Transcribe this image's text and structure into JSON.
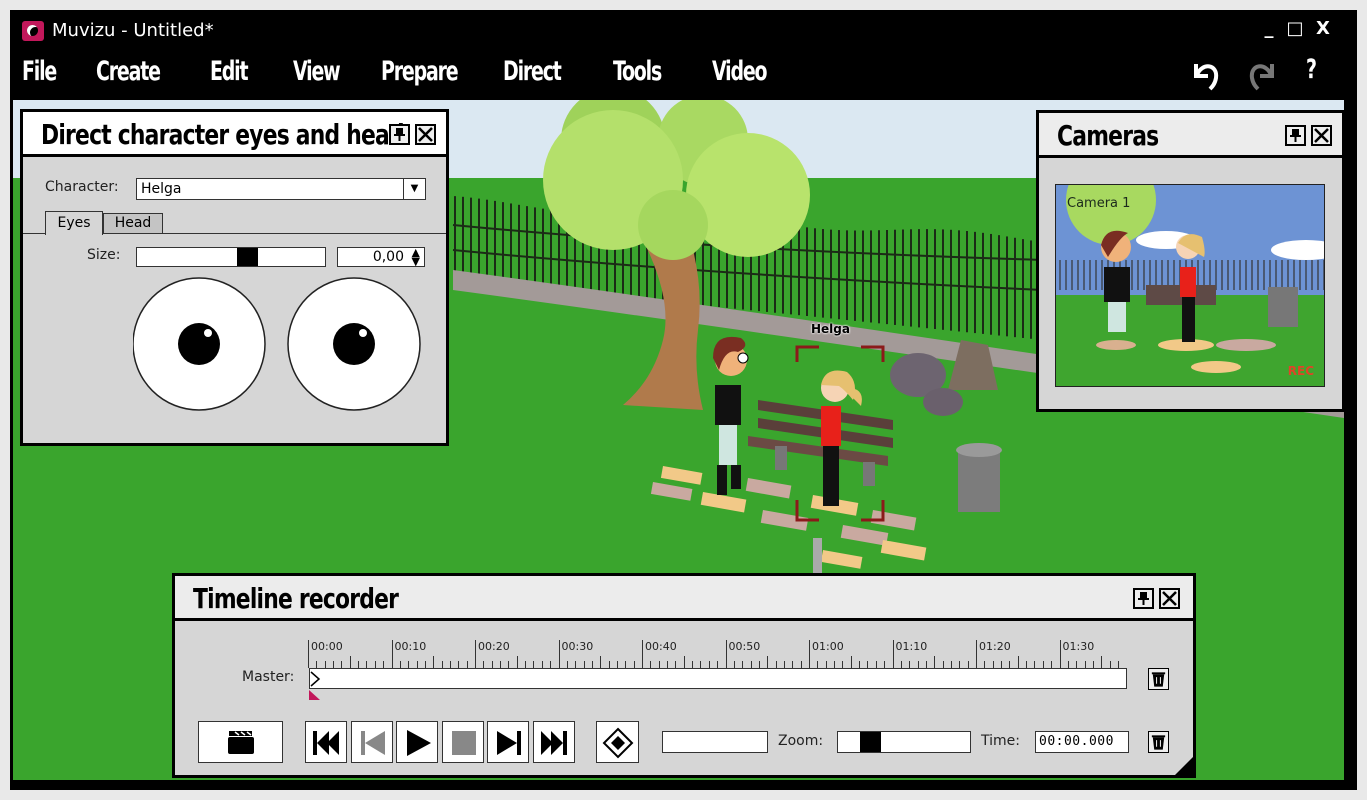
{
  "window": {
    "title": "Muvizu - Untitled*",
    "controls": {
      "minimize": "_",
      "maximize": "□",
      "close": "X"
    }
  },
  "menu": {
    "items": [
      {
        "label": "File"
      },
      {
        "label": "Create"
      },
      {
        "label": "Edit"
      },
      {
        "label": "View"
      },
      {
        "label": "Prepare"
      },
      {
        "label": "Direct"
      },
      {
        "label": "Tools"
      },
      {
        "label": "Video"
      }
    ],
    "toolbar": {
      "undo": "undo-icon",
      "redo": "redo-icon",
      "help": "?"
    }
  },
  "eyes_panel": {
    "title": "Direct character eyes and head",
    "character_label": "Character:",
    "character_value": "Helga",
    "tabs": [
      {
        "label": "Eyes",
        "active": true
      },
      {
        "label": "Head",
        "active": false
      }
    ],
    "size_label": "Size:",
    "size_value": "0,00",
    "size_slider_fraction": 0.6
  },
  "cameras_panel": {
    "title": "Cameras",
    "camera_name": "Camera 1",
    "rec_label": "REC"
  },
  "scene": {
    "selected_character_label": "Helga",
    "accent_color": "#8b1a1a"
  },
  "timeline": {
    "title": "Timeline recorder",
    "master_label": "Master:",
    "ruler_labels": [
      "00:00",
      "00:10",
      "00:20",
      "00:30",
      "00:40",
      "00:50",
      "01:00",
      "01:10",
      "01:20",
      "01:30"
    ],
    "zoom_label": "Zoom:",
    "zoom_slider_fraction": 0.2,
    "time_label": "Time:",
    "time_value": "00:00.000",
    "transport": [
      "go-to-start",
      "step-back",
      "play",
      "stop",
      "step-forward",
      "go-to-end"
    ],
    "playhead_color": "#c2185b"
  }
}
